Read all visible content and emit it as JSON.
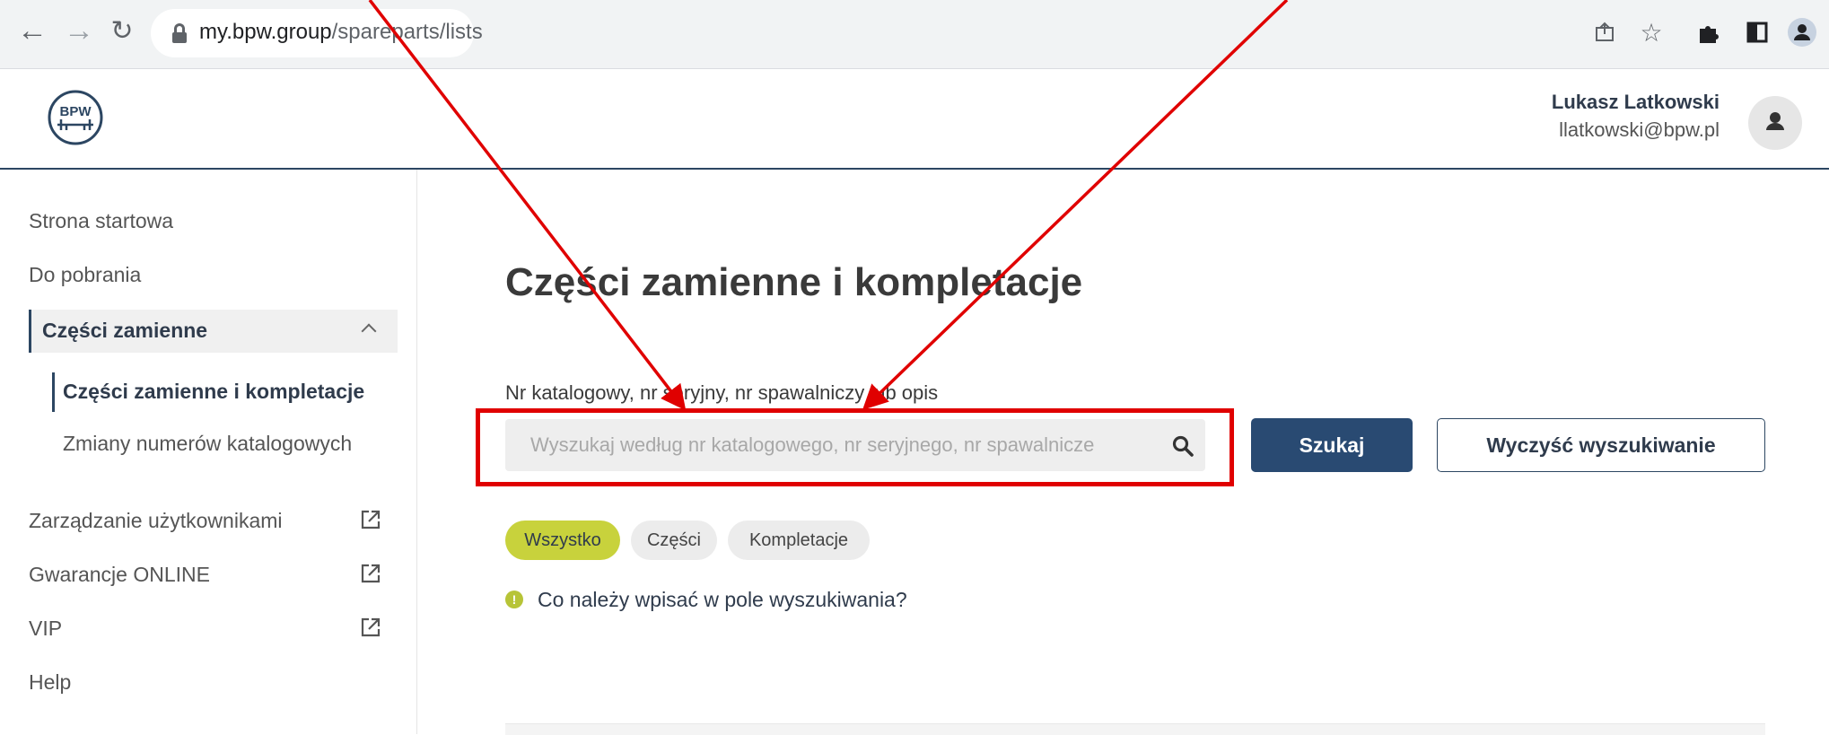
{
  "browser": {
    "url_domain": "my.bpw.group",
    "url_path": "/spareparts/lists",
    "back_icon": "arrow-left-icon",
    "forward_icon": "arrow-right-icon",
    "reload_icon": "reload-icon",
    "toolbar_icons": [
      "share-icon",
      "star-icon",
      "extensions-icon",
      "sidepanel-icon",
      "profile-icon"
    ]
  },
  "header": {
    "logo_text": "BPW",
    "user_name": "Lukasz Latkowski",
    "user_email": "llatkowski@bpw.pl"
  },
  "sidebar": {
    "items": [
      {
        "label": "Strona startowa"
      },
      {
        "label": "Do pobrania"
      },
      {
        "label": "Części zamienne",
        "expanded": true
      },
      {
        "label": "Części zamienne i kompletacje",
        "active": true
      },
      {
        "label": "Zmiany numerów katalogowych"
      },
      {
        "label": "Zarządzanie użytkownikami",
        "external": true
      },
      {
        "label": "Gwarancje ONLINE",
        "external": true
      },
      {
        "label": "VIP",
        "external": true
      },
      {
        "label": "Help"
      }
    ]
  },
  "main": {
    "title": "Części zamienne i kompletacje",
    "search_label": "Nr katalogowy, nr seryjny, nr spawalniczy lub opis",
    "search_placeholder": "Wyszukaj według nr katalogowego, nr seryjnego, nr spawalnicze",
    "search_value": "",
    "search_button": "Szukaj",
    "clear_button": "Wyczyść wyszukiwanie",
    "filters": [
      {
        "label": "Wszystko",
        "active": true
      },
      {
        "label": "Części"
      },
      {
        "label": "Kompletacje"
      }
    ],
    "help_link": "Co należy wpisać w pole wyszukiwania?"
  },
  "colors": {
    "primary": "#294a72",
    "accent": "#c8d23c",
    "annotation": "#e00000"
  }
}
